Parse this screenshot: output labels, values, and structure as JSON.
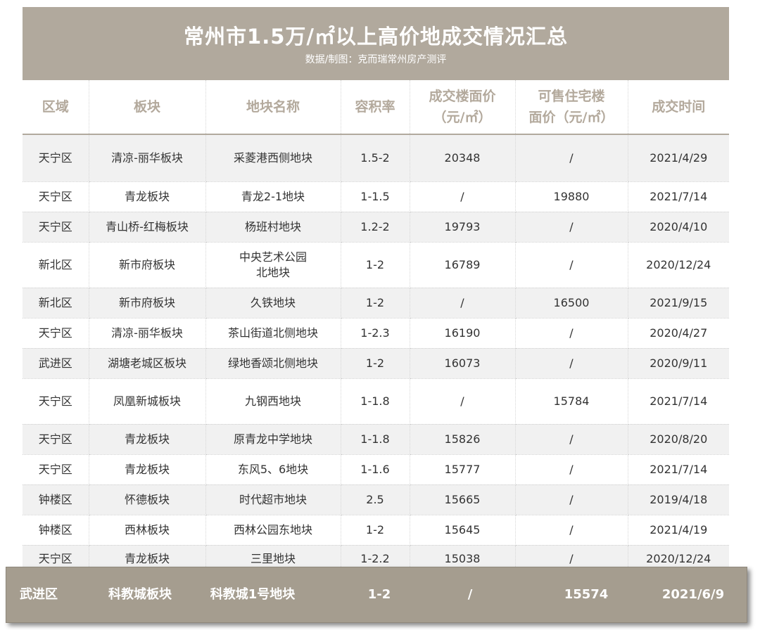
{
  "header": {
    "title": "常州市1.5万/㎡以上高价地成交情况汇总",
    "subtitle": "数据/制图：克而瑞常州房产测评"
  },
  "columns": [
    "区域",
    "板块",
    "地块名称",
    "容积率",
    "成交楼面价\n（元/㎡）",
    "可售住宅楼\n面价（元/㎡）",
    "成交时间"
  ],
  "rows": [
    [
      "天宁区",
      "清凉-丽华板块",
      "采菱港西侧地块",
      "1.5-2",
      "20348",
      "/",
      "2021/4/29"
    ],
    [
      "天宁区",
      "青龙板块",
      "青龙2-1地块",
      "1-1.5",
      "/",
      "19880",
      "2021/7/14"
    ],
    [
      "天宁区",
      "青山桥-红梅板块",
      "杨班村地块",
      "1.2-2",
      "19793",
      "/",
      "2020/4/10"
    ],
    [
      "新北区",
      "新市府板块",
      "中央艺术公园\n北地块",
      "1-2",
      "16789",
      "/",
      "2020/12/24"
    ],
    [
      "新北区",
      "新市府板块",
      "久铁地块",
      "1-2",
      "/",
      "16500",
      "2021/9/15"
    ],
    [
      "天宁区",
      "清凉-丽华板块",
      "茶山街道北侧地块",
      "1-2.3",
      "16190",
      "/",
      "2020/4/27"
    ],
    [
      "武进区",
      "湖塘老城区板块",
      "绿地香颂北侧地块",
      "1-2",
      "16073",
      "/",
      "2020/9/11"
    ],
    [
      "天宁区",
      "凤凰新城板块",
      "九钢西地块",
      "1-1.8",
      "/",
      "15784",
      "2021/7/14"
    ],
    [
      "天宁区",
      "青龙板块",
      "原青龙中学地块",
      "1-1.8",
      "15826",
      "/",
      "2020/8/20"
    ],
    [
      "天宁区",
      "青龙板块",
      "东风5、6地块",
      "1-1.6",
      "15777",
      "/",
      "2021/7/14"
    ],
    [
      "钟楼区",
      "怀德板块",
      "时代超市地块",
      "2.5",
      "15665",
      "/",
      "2019/4/18"
    ],
    [
      "钟楼区",
      "西林板块",
      "西林公园东地块",
      "1-2",
      "15645",
      "/",
      "2021/4/19"
    ],
    [
      "天宁区",
      "青龙板块",
      "三里地块",
      "1-2.2",
      "15038",
      "/",
      "2020/12/24"
    ]
  ],
  "highlight_row": [
    "武进区",
    "科教城板块",
    "科教城1号地块",
    "1-2",
    "/",
    "15574",
    "2021/6/9"
  ]
}
